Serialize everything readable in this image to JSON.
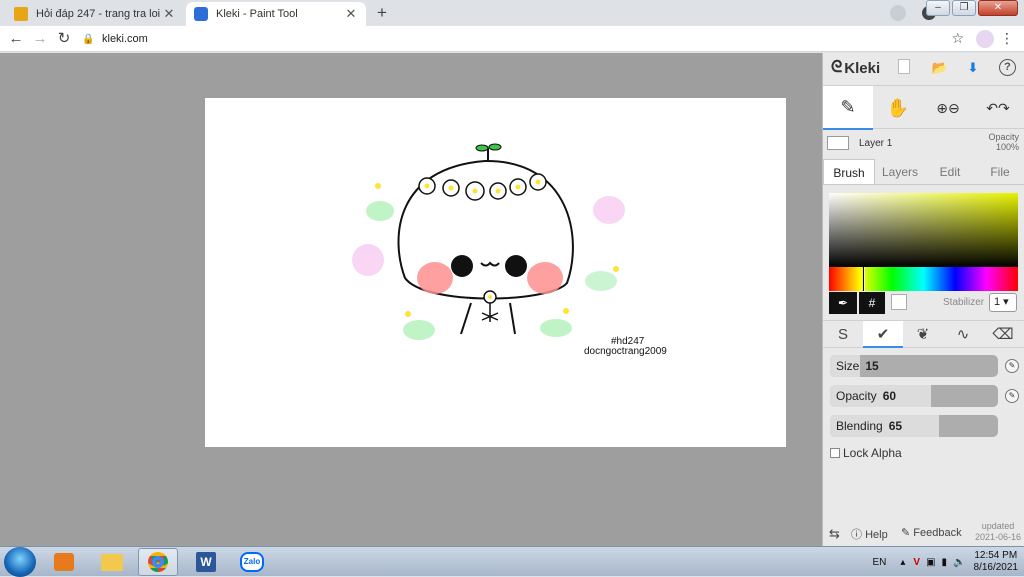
{
  "browser": {
    "tabs": [
      {
        "title": "Hỏi đáp 247 - trang tra loi",
        "favicon_color": "#e8a516"
      },
      {
        "title": "Kleki - Paint Tool",
        "favicon_color": "#2d6fd6"
      }
    ],
    "url": "kleki.com"
  },
  "app": {
    "name": "Kleki",
    "layer": {
      "name": "Layer 1",
      "opacity_label": "Opacity",
      "opacity_value": "100%"
    },
    "tabs": [
      "Brush",
      "Layers",
      "Edit",
      "File"
    ],
    "active_tab": "Brush",
    "stabilizer": {
      "label": "Stabilizer",
      "value": "1"
    },
    "hex_label": "#",
    "sliders": {
      "size": {
        "label": "Size",
        "value": "15",
        "fraction": 0.15
      },
      "opacity": {
        "label": "Opacity",
        "value": "60",
        "fraction": 0.6
      },
      "blending": {
        "label": "Blending",
        "value": "65",
        "fraction": 0.65
      }
    },
    "lock_alpha": "Lock Alpha",
    "footer": {
      "help": "Help",
      "feedback": "Feedback",
      "updated_label": "updated",
      "updated_date": "2021-06-16"
    },
    "accent_color": "#3a8de0"
  },
  "canvas": {
    "caption_line1": "#hd247",
    "caption_line2": "docngoctrang2009"
  },
  "taskbar": {
    "language": "EN",
    "time": "12:54 PM",
    "date": "8/16/2021",
    "items": [
      "media-player",
      "explorer",
      "chrome",
      "word",
      "zalo"
    ],
    "zalo_label": "Zalo",
    "word_label": "W"
  }
}
